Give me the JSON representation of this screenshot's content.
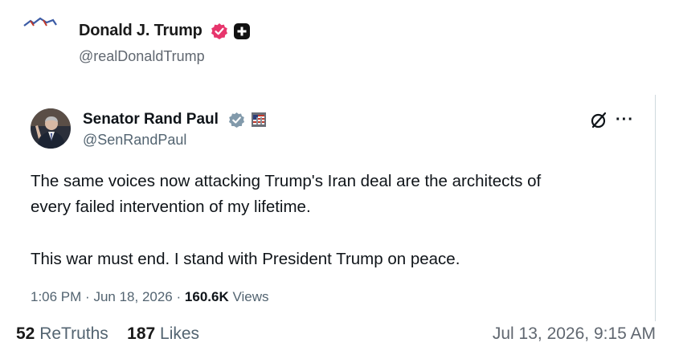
{
  "post": {
    "author_name": "Donald J. Trump",
    "author_handle": "@realDonaldTrump",
    "retruths_count": "52",
    "retruths_label": "ReTruths",
    "likes_count": "187",
    "likes_label": "Likes",
    "date": "Jul 13, 2026, 9:15 AM"
  },
  "quoted": {
    "name": "Senator Rand Paul",
    "handle": "@SenRandPaul",
    "line1": "The same voices now attacking Trump's Iran deal are the architects of",
    "line2": "every failed intervention of my lifetime.",
    "line3": "This war must end. I stand with President Trump on peace.",
    "time": "1:06 PM",
    "date": "Jun 18, 2026",
    "views_count": "160.6K",
    "views_label": "Views",
    "more_label": "···"
  },
  "colors": {
    "truth_verified": "#e7356c",
    "x_verified": "#829aab",
    "muted_text": "#536471"
  }
}
